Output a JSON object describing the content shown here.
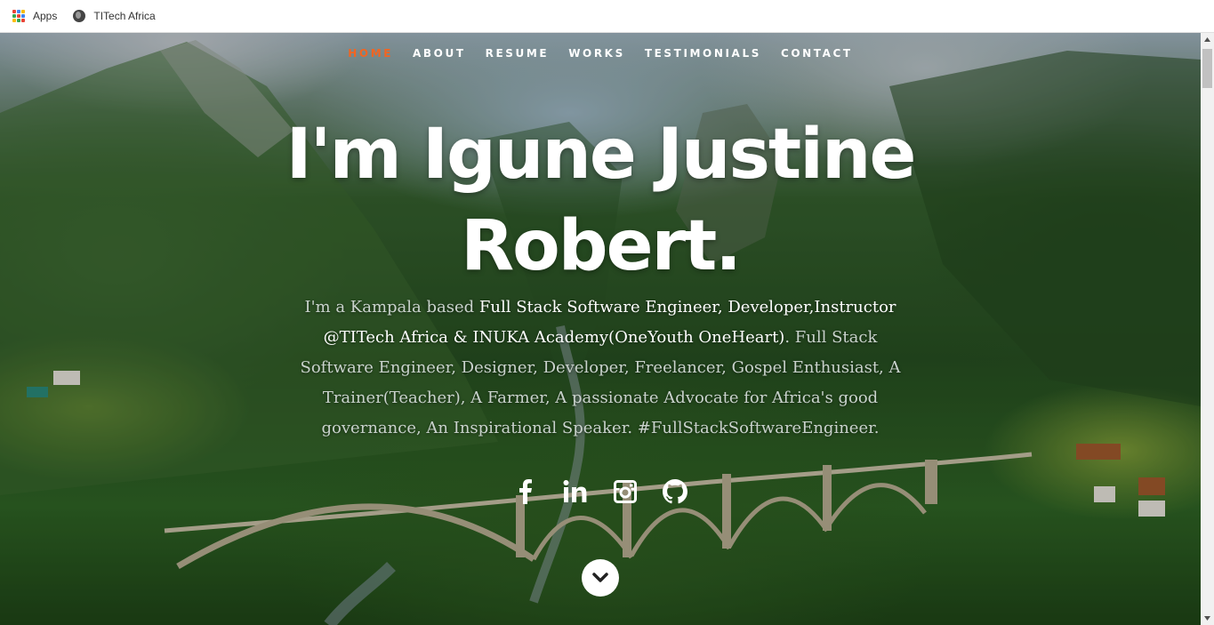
{
  "bookmarks": {
    "apps_label": "Apps",
    "site_label": "TITech Africa"
  },
  "nav": {
    "items": [
      "HOME",
      "ABOUT",
      "RESUME",
      "WORKS",
      "TESTIMONIALS",
      "CONTACT"
    ],
    "active": "HOME",
    "active_color": "#f26522"
  },
  "hero": {
    "title_line1": "I'm Igune Justine",
    "title_line2": "Robert.",
    "intro_start": "I'm a Kampala based ",
    "intro_highlight": "Full Stack Software Engineer, Developer,Instructor @TITech Africa & INUKA Academy(OneYouth OneHeart)",
    "intro_rest": ". Full Stack Software Engineer, Designer, Developer, Freelancer, Gospel Enthusiast, A Trainer(Teacher), A Farmer, A passionate Advocate for Africa's good governance, An Inspirational Speaker. #FullStackSoftwareEngineer."
  },
  "social": {
    "icons": [
      "facebook-icon",
      "linkedin-icon",
      "instagram-icon",
      "github-icon"
    ]
  }
}
